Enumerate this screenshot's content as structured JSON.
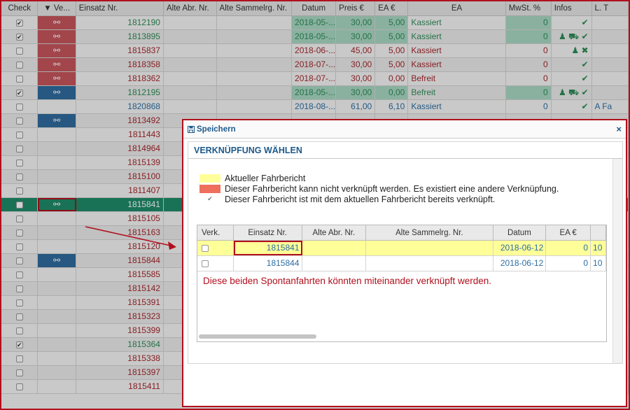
{
  "grid": {
    "headers": [
      "Check",
      "▼ Ve...",
      "Einsatz Nr.",
      "Alte Abr. Nr.",
      "Alte Sammelrg. Nr.",
      "Datum",
      "Preis €",
      "EA €",
      "EA",
      "MwSt. %",
      "Infos",
      "L. T"
    ],
    "rows": [
      {
        "check": "✔",
        "link": "red",
        "einsatz": "1812190",
        "cls": "green",
        "datum": "2018-05-...",
        "preis": "30,00",
        "ea": "5,00",
        "ea_text": "Kassiert",
        "mwst": "0",
        "infos": "✔",
        "lt": "",
        "greenbg": true
      },
      {
        "check": "✔",
        "link": "red",
        "einsatz": "1813895",
        "cls": "green",
        "datum": "2018-05-...",
        "preis": "30,00",
        "ea": "5,00",
        "ea_text": "Kassiert",
        "mwst": "0",
        "infos": "♟ ⛟ ✔",
        "lt": "",
        "greenbg": true
      },
      {
        "check": "",
        "link": "red",
        "einsatz": "1815837",
        "cls": "red",
        "datum": "2018-06-...",
        "preis": "45,00",
        "ea": "5,00",
        "ea_text": "Kassiert",
        "mwst": "0",
        "infos": "♟ ✖",
        "lt": "",
        "greenbg": false
      },
      {
        "check": "",
        "link": "red",
        "einsatz": "1818358",
        "cls": "red",
        "datum": "2018-07-...",
        "preis": "30,00",
        "ea": "5,00",
        "ea_text": "Kassiert",
        "mwst": "0",
        "infos": "✔",
        "lt": "",
        "greenbg": false
      },
      {
        "check": "",
        "link": "red",
        "einsatz": "1818362",
        "cls": "red",
        "datum": "2018-07-...",
        "preis": "30,00",
        "ea": "0,00",
        "ea_text": "Befreit",
        "mwst": "0",
        "infos": "✔",
        "lt": "",
        "greenbg": false
      },
      {
        "check": "✔",
        "link": "blue",
        "einsatz": "1812195",
        "cls": "green",
        "datum": "2018-05-...",
        "preis": "30,00",
        "ea": "0,00",
        "ea_text": "Befreit",
        "mwst": "0",
        "infos": "♟ ⛟ ✔",
        "lt": "",
        "greenbg": true
      },
      {
        "check": "",
        "link": "",
        "einsatz": "1820868",
        "cls": "blue",
        "datum": "2018-08-...",
        "preis": "61,00",
        "ea": "6,10",
        "ea_text": "Kassiert",
        "mwst": "0",
        "infos": "✔",
        "lt": "A Fa",
        "greenbg": false
      },
      {
        "check": "",
        "link": "blue",
        "einsatz": "1813492",
        "cls": "red"
      },
      {
        "check": "",
        "link": "",
        "einsatz": "1811443",
        "cls": "red"
      },
      {
        "check": "",
        "link": "",
        "einsatz": "1814964",
        "cls": "red"
      },
      {
        "check": "",
        "link": "",
        "einsatz": "1815139",
        "cls": "red"
      },
      {
        "check": "",
        "link": "",
        "einsatz": "1815100",
        "cls": "red"
      },
      {
        "check": "",
        "link": "",
        "einsatz": "1811407",
        "cls": "red"
      },
      {
        "check": "",
        "link": "sel",
        "einsatz": "1815841",
        "cls": "sel"
      },
      {
        "check": "",
        "link": "",
        "einsatz": "1815105",
        "cls": "red"
      },
      {
        "check": "",
        "link": "",
        "einsatz": "1815163",
        "cls": "red"
      },
      {
        "check": "",
        "link": "",
        "einsatz": "1815120",
        "cls": "red"
      },
      {
        "check": "",
        "link": "blue",
        "einsatz": "1815844",
        "cls": "red"
      },
      {
        "check": "",
        "link": "",
        "einsatz": "1815585",
        "cls": "red"
      },
      {
        "check": "",
        "link": "",
        "einsatz": "1815142",
        "cls": "red"
      },
      {
        "check": "",
        "link": "",
        "einsatz": "1815391",
        "cls": "red"
      },
      {
        "check": "",
        "link": "",
        "einsatz": "1815323",
        "cls": "red"
      },
      {
        "check": "",
        "link": "",
        "einsatz": "1815399",
        "cls": "red"
      },
      {
        "check": "✔",
        "link": "",
        "einsatz": "1815364",
        "cls": "green"
      },
      {
        "check": "",
        "link": "",
        "einsatz": "1815338",
        "cls": "red"
      },
      {
        "check": "",
        "link": "",
        "einsatz": "1815397",
        "cls": "red"
      },
      {
        "check": "",
        "link": "",
        "einsatz": "1815411",
        "cls": "red"
      }
    ]
  },
  "dialog": {
    "save_label": "Speichern",
    "close_label": "×",
    "title": "VERKNÜPFUNG WÄHLEN",
    "legend": {
      "current": "Aktueller Fahrbericht",
      "blocked": "Dieser Fahrbericht kann nicht verknüpft werden. Es existiert eine andere Verknüpfung.",
      "linked": "Dieser Fahrbericht ist mit dem aktuellen Fahrbericht bereits verknüpft."
    },
    "table": {
      "headers": [
        "Verk.",
        "Einsatz Nr.",
        "Alte Abr. Nr.",
        "Alte Sammelrg. Nr.",
        "Datum",
        "EA €",
        ""
      ],
      "rows": [
        {
          "einsatz": "1815841",
          "datum": "2018-06-12",
          "ea": "0",
          "more": "10",
          "current": true
        },
        {
          "einsatz": "1815844",
          "datum": "2018-06-12",
          "ea": "0",
          "more": "10",
          "current": false
        }
      ],
      "hint": "Diese beiden Spontanfahrten könnten miteinander verknüpft werden."
    }
  }
}
